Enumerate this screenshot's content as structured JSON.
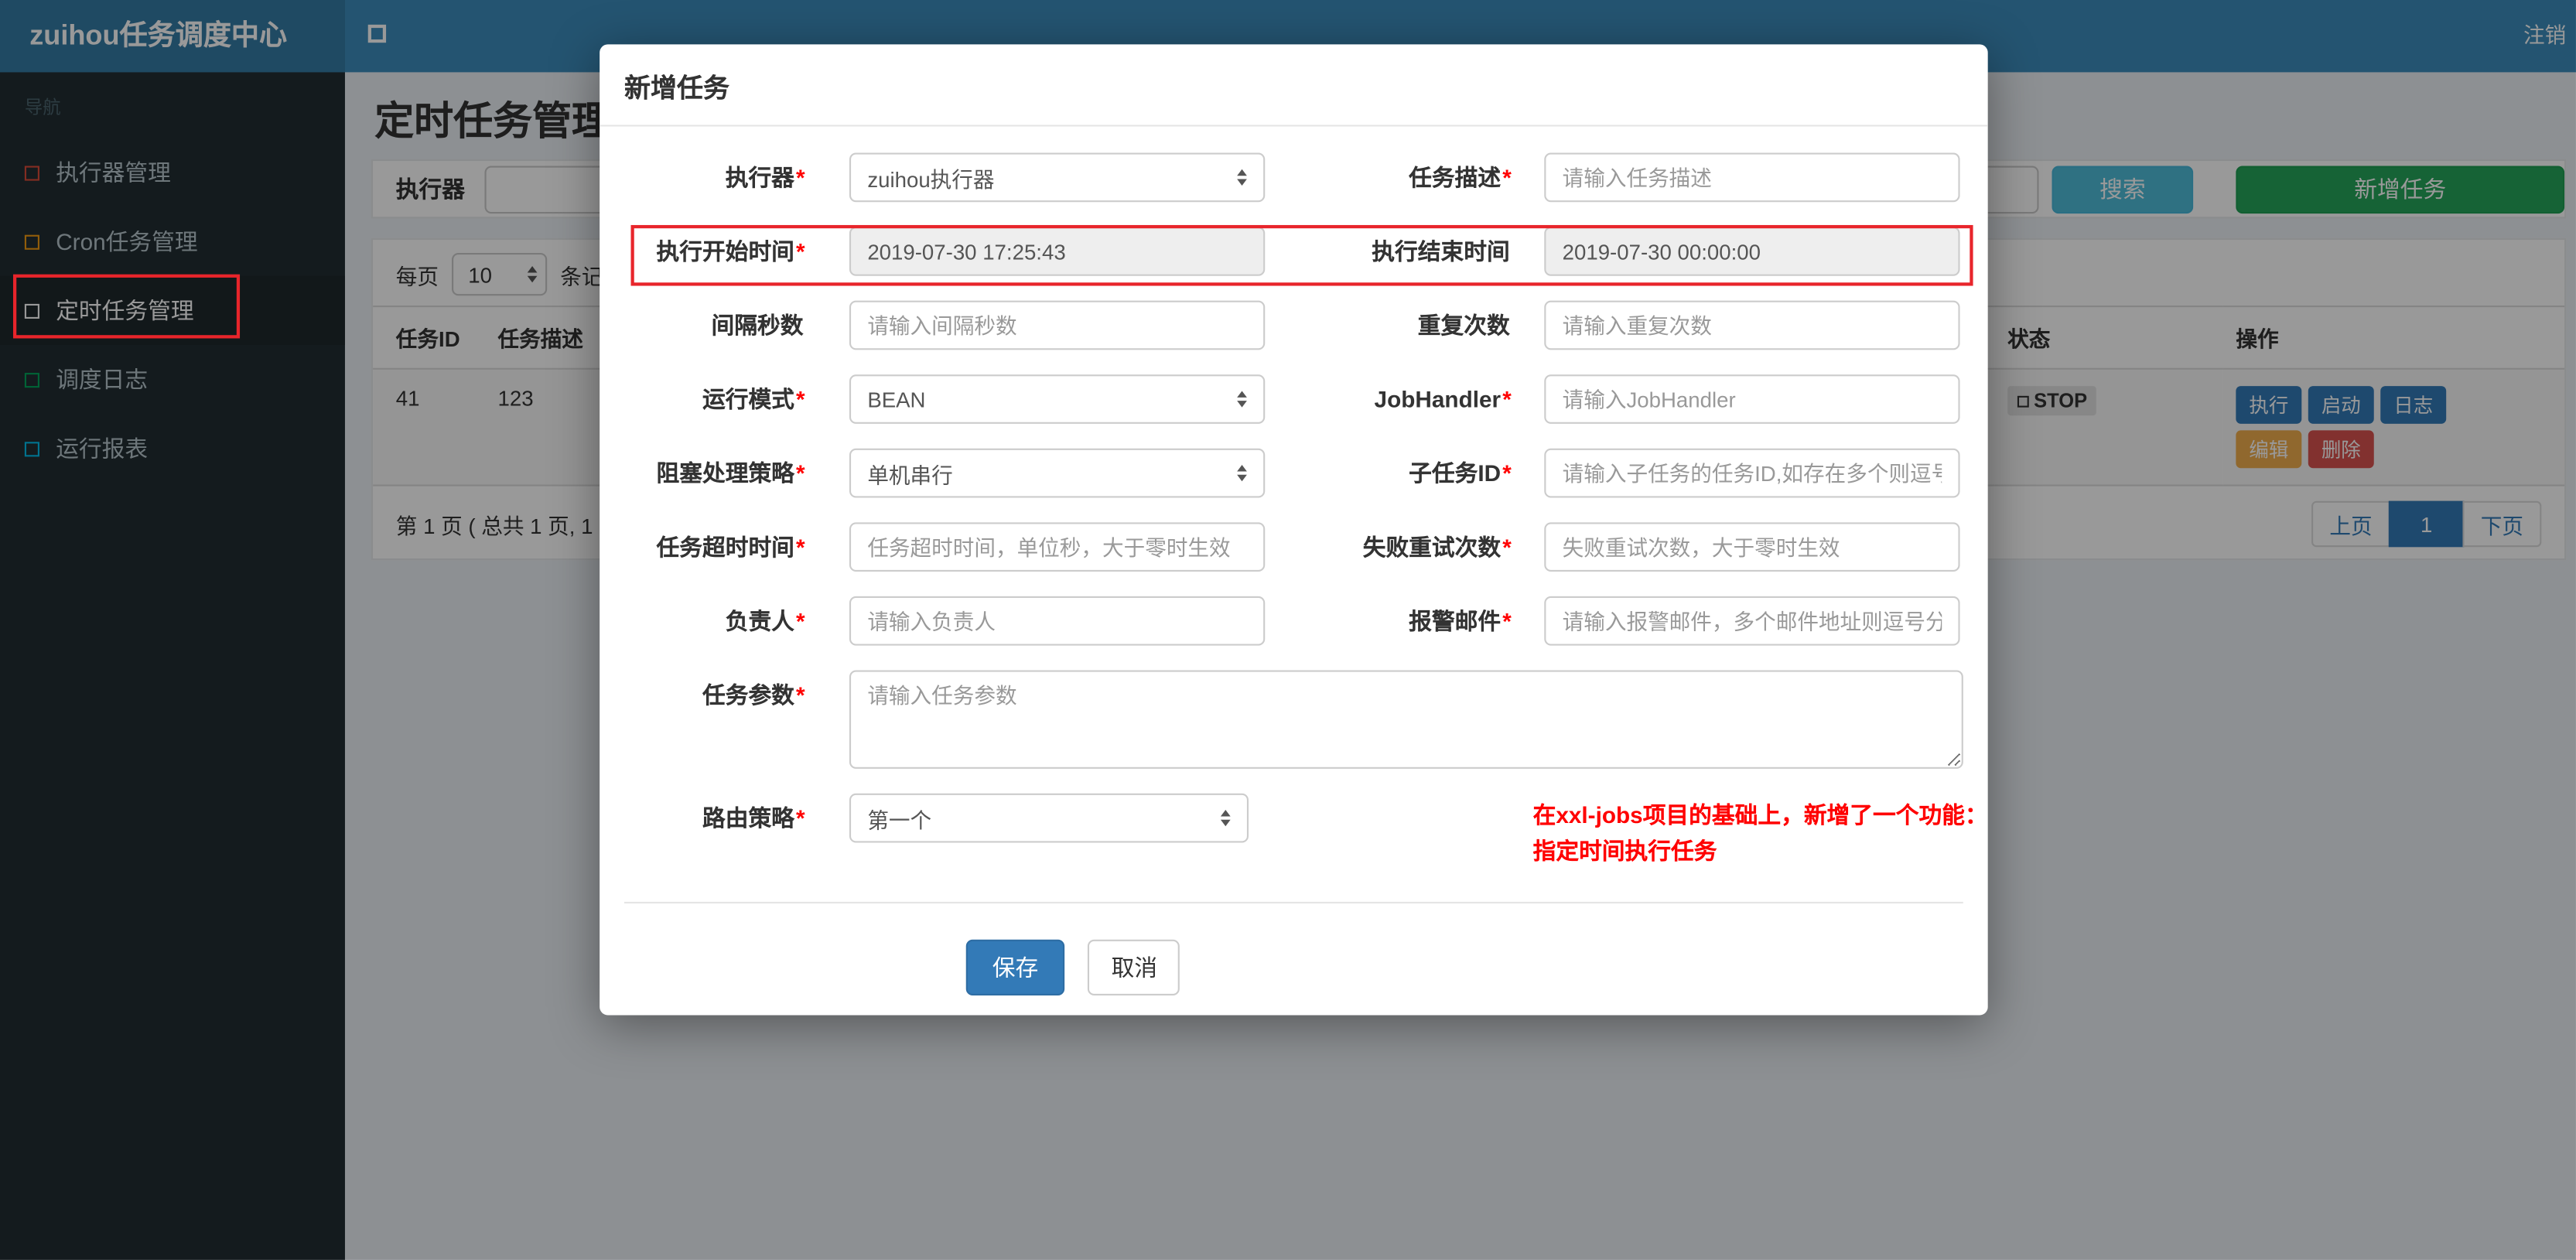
{
  "navbar": {
    "brand": "zuihou任务调度中心",
    "logout": "注销"
  },
  "sidebar": {
    "section": "导航",
    "items": [
      {
        "label": "执行器管理",
        "icon_color": "#dd4b39",
        "active": false
      },
      {
        "label": "Cron任务管理",
        "icon_color": "#f39c12",
        "active": false
      },
      {
        "label": "定时任务管理",
        "icon_color": "#ffffff",
        "active": true
      },
      {
        "label": "调度日志",
        "icon_color": "#00a65a",
        "active": false
      },
      {
        "label": "运行报表",
        "icon_color": "#00c0ef",
        "active": false
      }
    ]
  },
  "page": {
    "title": "定时任务管理",
    "filter": {
      "executor_label": "执行器",
      "search_button": "搜索",
      "add_button": "新增任务"
    },
    "per_page": {
      "label": "每页",
      "value": "10",
      "suffix": "条记录"
    },
    "table": {
      "headers": [
        "任务ID",
        "任务描述",
        "状态",
        "操作"
      ],
      "row": {
        "id": "41",
        "desc": "123",
        "status": "STOP",
        "ops": [
          "执行",
          "启动",
          "日志",
          "编辑",
          "删除"
        ]
      }
    },
    "pagination": {
      "summary": "第 1 页 ( 总共 1 页, 1",
      "prev": "上页",
      "current": "1",
      "next": "下页"
    }
  },
  "modal": {
    "title": "新增任务",
    "rows": [
      {
        "left": {
          "label": "执行器",
          "star": "*",
          "value": "zuihou执行器"
        },
        "right": {
          "label": "任务描述",
          "star": "*",
          "placeholder": "请输入任务描述"
        }
      },
      {
        "left": {
          "label": "执行开始时间",
          "star": "*",
          "value": "2019-07-30 17:25:43"
        },
        "right": {
          "label": "执行结束时间",
          "star": "",
          "value": "2019-07-30 00:00:00"
        }
      },
      {
        "left": {
          "label": "间隔秒数",
          "star": "",
          "placeholder": "请输入间隔秒数"
        },
        "right": {
          "label": "重复次数",
          "star": "",
          "placeholder": "请输入重复次数"
        }
      },
      {
        "left": {
          "label": "运行模式",
          "star": "*",
          "value": "BEAN"
        },
        "right": {
          "label": "JobHandler",
          "star": "*",
          "placeholder": "请输入JobHandler"
        }
      },
      {
        "left": {
          "label": "阻塞处理策略",
          "star": "*",
          "value": "单机串行"
        },
        "right": {
          "label": "子任务ID",
          "star": "*",
          "placeholder": "请输入子任务的任务ID,如存在多个则逗号分隔"
        }
      },
      {
        "left": {
          "label": "任务超时时间",
          "star": "*",
          "placeholder": "任务超时时间，单位秒，大于零时生效"
        },
        "right": {
          "label": "失败重试次数",
          "star": "*",
          "placeholder": "失败重试次数，大于零时生效"
        }
      },
      {
        "left": {
          "label": "负责人",
          "star": "*",
          "placeholder": "请输入负责人"
        },
        "right": {
          "label": "报警邮件",
          "star": "*",
          "placeholder": "请输入报警邮件，多个邮件地址则逗号分隔"
        }
      }
    ],
    "params": {
      "label": "任务参数",
      "star": "*",
      "placeholder": "请输入任务参数"
    },
    "route": {
      "label": "路由策略",
      "star": "*",
      "value": "第一个"
    },
    "note_line1": "在xxl-jobs项目的基础上，新增了一个功能：",
    "note_line2": "指定时间执行任务",
    "save_button": "保存",
    "cancel_button": "取消"
  },
  "colors": {
    "navbar_blue": "#3c8dbc",
    "sidebar_dark": "#222d32",
    "accent_blue": "#337ab7",
    "search_teal": "#4fbcd9",
    "add_green": "#26a65a",
    "edit_orange": "#f0ad4e",
    "delete_red": "#d9534f",
    "annotation_red": "#e8252b"
  }
}
